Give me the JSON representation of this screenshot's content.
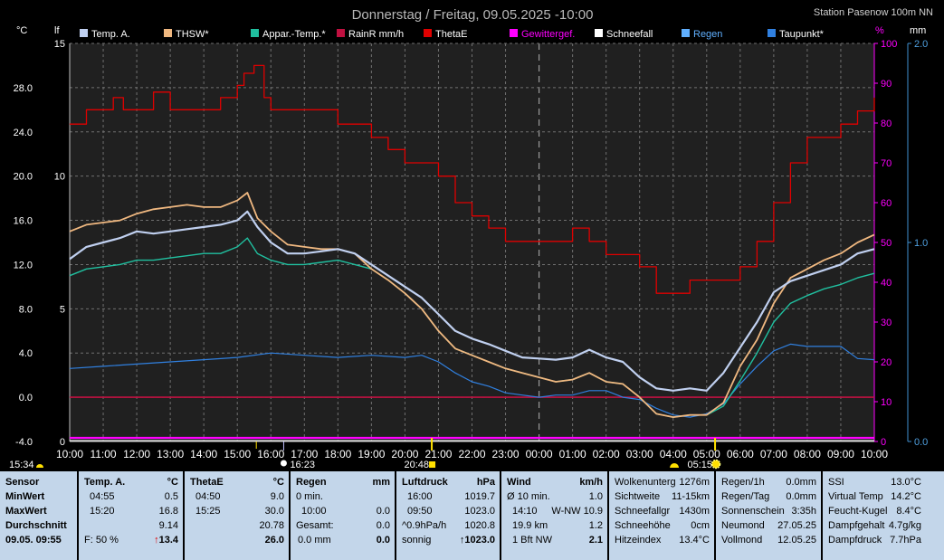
{
  "chart_data": {
    "type": "line",
    "title": "Donnerstag / Freitag, 09.05.2025  -10:00",
    "station": "Station Pasenow 100m NN",
    "x_ticks": [
      "10:00",
      "11:00",
      "12:00",
      "13:00",
      "14:00",
      "15:00",
      "16:00",
      "17:00",
      "18:00",
      "19:00",
      "20:00",
      "21:00",
      "22:00",
      "23:00",
      "00:00",
      "01:00",
      "02:00",
      "03:00",
      "04:00",
      "05:00",
      "06:00",
      "07:00",
      "08:00",
      "09:00",
      "10:00"
    ],
    "x_range_hours": [
      0,
      24
    ],
    "midnight_hour": 14,
    "axes": {
      "celsius": {
        "label": "°C",
        "ticks": [
          "28.0",
          "24.0",
          "20.0",
          "16.0",
          "12.0",
          "8.0",
          "4.0",
          "0.0",
          "-4.0"
        ],
        "range": [
          -4,
          32
        ]
      },
      "lf": {
        "label": "lf",
        "ticks": [
          "15",
          "10",
          "5",
          "0"
        ],
        "range": [
          0,
          15
        ]
      },
      "percent": {
        "label": "%",
        "ticks": [
          "100",
          "90",
          "80",
          "70",
          "60",
          "50",
          "40",
          "30",
          "20",
          "10",
          "0"
        ],
        "range": [
          0,
          100
        ]
      },
      "mm": {
        "label": "mm",
        "ticks": [
          "2.0",
          "1.0",
          "0.0"
        ],
        "range": [
          0,
          2
        ]
      }
    },
    "legend": [
      {
        "name": "Temp. A.",
        "color": "#c0d0f0"
      },
      {
        "name": "THSW*",
        "color": "#f0b880"
      },
      {
        "name": "Appar.-Temp.*",
        "color": "#20c0a0"
      },
      {
        "name": "RainR mm/h",
        "color": "#c01040"
      },
      {
        "name": "ThetaE",
        "color": "#e00000"
      },
      {
        "name": "Gewittergef.",
        "color": "#ff00ff"
      },
      {
        "name": "Schneefall",
        "color": "#ffffff"
      },
      {
        "name": "Regen",
        "color": "#60b0ff"
      },
      {
        "name": "Taupunkt*",
        "color": "#3080e0"
      }
    ],
    "series": [
      {
        "name": "Temp. A.",
        "color": "#c0d0f0",
        "axis": "celsius",
        "x": [
          0,
          0.5,
          1,
          1.5,
          2,
          2.5,
          3,
          3.5,
          4,
          4.5,
          5,
          5.3,
          5.6,
          6,
          6.5,
          7,
          7.5,
          8,
          8.5,
          9,
          9.5,
          10,
          10.5,
          11,
          11.5,
          12,
          12.5,
          13,
          13.5,
          14,
          14.5,
          15,
          15.5,
          16,
          16.5,
          17,
          17.5,
          18,
          18.5,
          19,
          19.5,
          20,
          20.5,
          21,
          21.5,
          22,
          22.5,
          23,
          23.5,
          24
        ],
        "y": [
          12.5,
          13.6,
          14,
          14.4,
          15,
          14.8,
          15,
          15.2,
          15.4,
          15.6,
          16,
          16.8,
          15.4,
          14,
          13,
          13,
          13.2,
          13.4,
          13,
          12,
          11,
          10,
          9,
          7.5,
          6,
          5.3,
          4.8,
          4.2,
          3.6,
          3.5,
          3.4,
          3.6,
          4.3,
          3.6,
          3.2,
          1.8,
          0.8,
          0.6,
          0.8,
          0.6,
          2.2,
          4.5,
          6.8,
          9.5,
          10.5,
          11,
          11.5,
          12,
          13,
          13.4
        ]
      },
      {
        "name": "THSW*",
        "color": "#f0b880",
        "axis": "celsius",
        "x": [
          0,
          0.5,
          1,
          1.5,
          2,
          2.5,
          3,
          3.5,
          4,
          4.5,
          5,
          5.3,
          5.6,
          6,
          6.5,
          7,
          7.5,
          8,
          8.5,
          9,
          9.5,
          10,
          10.5,
          11,
          11.5,
          12,
          12.5,
          13,
          13.5,
          14,
          14.5,
          15,
          15.5,
          16,
          16.5,
          17,
          17.5,
          18,
          18.5,
          19,
          19.5,
          20,
          20.5,
          21,
          21.5,
          22,
          22.5,
          23,
          23.5,
          24
        ],
        "y": [
          15,
          15.6,
          15.8,
          16,
          16.6,
          17,
          17.2,
          17.4,
          17.2,
          17.2,
          17.8,
          18.5,
          16.2,
          15,
          13.8,
          13.6,
          13.4,
          13.4,
          13,
          11.6,
          10.6,
          9.4,
          8,
          6,
          4.4,
          3.8,
          3.2,
          2.6,
          2.2,
          1.8,
          1.4,
          1.6,
          2.2,
          1.4,
          1.2,
          0,
          -1.5,
          -1.8,
          -1.6,
          -1.6,
          -0.5,
          2.8,
          5.2,
          8.5,
          10.8,
          11.6,
          12.4,
          13,
          14,
          14.7
        ]
      },
      {
        "name": "Appar.-Temp.*",
        "color": "#20c0a0",
        "axis": "celsius",
        "x": [
          0,
          0.5,
          1,
          1.5,
          2,
          2.5,
          3,
          3.5,
          4,
          4.5,
          5,
          5.3,
          5.6,
          6,
          6.5,
          7,
          7.5,
          8,
          8.5,
          9,
          9.5,
          10,
          10.5,
          11,
          11.5,
          12,
          12.5,
          13,
          13.5,
          14,
          14.5,
          15,
          15.5,
          16,
          16.5,
          17,
          17.5,
          18,
          18.5,
          19,
          19.5,
          20,
          20.5,
          21,
          21.5,
          22,
          22.5,
          23,
          23.5,
          24
        ],
        "y": [
          11,
          11.6,
          11.8,
          12,
          12.4,
          12.4,
          12.6,
          12.8,
          13,
          13,
          13.6,
          14.4,
          13,
          12.4,
          12,
          12,
          12.2,
          12.4,
          12,
          11.6,
          10.6,
          9.4,
          8,
          6,
          4.4,
          3.8,
          3.2,
          2.6,
          2.2,
          1.8,
          1.4,
          1.6,
          2.2,
          1.4,
          1.2,
          0,
          -1.5,
          -1.8,
          -1.6,
          -1.6,
          -0.8,
          1.5,
          4,
          6.8,
          8.5,
          9.2,
          9.8,
          10.2,
          10.8,
          11.2
        ]
      },
      {
        "name": "Taupunkt*",
        "color": "#3080e0",
        "axis": "celsius",
        "x": [
          0,
          1,
          2,
          3,
          4,
          5,
          6,
          7,
          8,
          9,
          10,
          10.5,
          11,
          11.5,
          12,
          12.5,
          13,
          13.5,
          14,
          14.5,
          15,
          15.5,
          16,
          16.5,
          17,
          17.5,
          18,
          18.5,
          19,
          19.5,
          20,
          20.5,
          21,
          21.5,
          22,
          22.5,
          23,
          23.5,
          24
        ],
        "y": [
          2.6,
          2.8,
          3,
          3.2,
          3.4,
          3.6,
          4,
          3.8,
          3.6,
          3.8,
          3.6,
          3.8,
          3.2,
          2.2,
          1.4,
          1,
          0.4,
          0.2,
          0,
          0.2,
          0.2,
          0.6,
          0.6,
          0,
          -0.2,
          -1,
          -1.6,
          -1.8,
          -1.5,
          -0.6,
          1.2,
          2.8,
          4.2,
          4.8,
          4.6,
          4.6,
          4.6,
          3.5,
          3.4
        ]
      },
      {
        "name": "ThetaE",
        "color": "#e00000",
        "axis": "celsius",
        "x": [
          0,
          0.5,
          1,
          1.3,
          1.6,
          2,
          2.5,
          3,
          3.5,
          4,
          4.5,
          5,
          5.2,
          5.5,
          5.8,
          6,
          7,
          8,
          9,
          9.5,
          10,
          11,
          11.5,
          12,
          12.5,
          13,
          13.5,
          14,
          14.5,
          15,
          15.5,
          16,
          16.5,
          17,
          17.5,
          18,
          18.5,
          19,
          19.5,
          20,
          20.5,
          21,
          21.5,
          22,
          22.5,
          23,
          23.5,
          24
        ],
        "y": [
          24.7,
          26,
          26,
          27.1,
          26,
          26,
          27.6,
          26,
          26,
          26,
          27.1,
          28.2,
          29.3,
          30,
          27.1,
          26,
          26,
          24.7,
          23.5,
          22.4,
          21.2,
          20,
          17.6,
          16.4,
          15.3,
          14.1,
          14.1,
          14.1,
          14.1,
          15.3,
          14.1,
          12.9,
          12.9,
          11.8,
          9.4,
          9.4,
          10.6,
          10.6,
          10.6,
          11.8,
          14.1,
          17.6,
          21.2,
          23.5,
          23.5,
          24.7,
          25.9,
          27.1
        ]
      },
      {
        "name": "RainR mm/h",
        "color": "#c01040",
        "axis": "mm",
        "x": [
          0,
          24
        ],
        "y": [
          0,
          0
        ]
      },
      {
        "name": "Gewittergef.",
        "color": "#ff00ff",
        "axis": "percent",
        "x": [
          0,
          24
        ],
        "y": [
          0,
          0
        ]
      }
    ],
    "bottom_markers": [
      {
        "time": "15:34",
        "icon": "sunset-icon"
      },
      {
        "time": "16:23",
        "icon": "moonrise-icon"
      },
      {
        "time": "20:48",
        "icon": "moonset-icon"
      },
      {
        "time": "05:15",
        "icon": "sunrise-icon"
      }
    ]
  },
  "panel": {
    "sensor": {
      "labels": [
        "Sensor",
        "MinWert",
        "MaxWert",
        "Durchschnitt",
        "09.05. 09:55"
      ]
    },
    "temp": {
      "header": "Temp. A.",
      "unit": "°C",
      "rows": [
        [
          "04:55",
          "0.5"
        ],
        [
          "15:20",
          "16.8"
        ],
        [
          "",
          "9.14"
        ]
      ],
      "footer_left": "F: 50 %",
      "footer_arrow": "↑",
      "footer_value": "13.4"
    },
    "thetae": {
      "header": "ThetaE",
      "unit": "°C",
      "rows": [
        [
          "04:50",
          "9.0"
        ],
        [
          "15:25",
          "30.0"
        ],
        [
          "",
          "20.78"
        ]
      ],
      "footer_value": "26.0"
    },
    "regen": {
      "header": "Regen",
      "unit": "mm",
      "rows": [
        [
          "0 min.",
          ""
        ],
        [
          "10:00",
          "0.0"
        ],
        [
          "Gesamt:",
          "0.0"
        ]
      ],
      "footer_left": "0.0 mm",
      "footer_value": "0.0"
    },
    "luftdruck": {
      "header": "Luftdruck",
      "unit": "hPa",
      "rows": [
        [
          "16:00",
          "1019.7"
        ],
        [
          "09:50",
          "1023.0"
        ],
        [
          "^0.9hPa/h",
          "1020.8"
        ]
      ],
      "footer_left": "sonnig",
      "footer_arrow": "↑",
      "footer_value": "1023.0"
    },
    "wind": {
      "header": "Wind",
      "unit": "km/h",
      "rows": [
        [
          "Ø 10 min.",
          "",
          "1.0"
        ],
        [
          "14:10",
          "W-NW",
          "10.9"
        ],
        [
          "19.9 km",
          "",
          "1.2"
        ]
      ],
      "footer_left": "1 Bft NW",
      "footer_value": "2.1"
    },
    "sicht": {
      "rows": [
        [
          "Wolkenunterg",
          "1276m"
        ],
        [
          "Sichtweite",
          "11-15km"
        ],
        [
          "Schneefallgr",
          "1430m"
        ],
        [
          "Schneehöhe",
          "0cm"
        ],
        [
          "Hitzeindex",
          "13.4°C"
        ]
      ]
    },
    "rain2": {
      "rows": [
        [
          "Regen/1h",
          "0.0mm"
        ],
        [
          "Regen/Tag",
          "0.0mm"
        ],
        [
          "Sonnenschein",
          "3:35h"
        ],
        [
          "Neumond",
          "27.05.25"
        ],
        [
          "Vollmond",
          "12.05.25"
        ]
      ]
    },
    "misc": {
      "rows": [
        [
          "SSI",
          "13.0°C"
        ],
        [
          "Virtual Temp",
          "14.2°C"
        ],
        [
          "Feucht-Kugel",
          "8.4°C"
        ],
        [
          "Dampfgehalt",
          "4.7g/kg"
        ],
        [
          "Dampfdruck",
          "7.7hPa"
        ]
      ]
    }
  }
}
